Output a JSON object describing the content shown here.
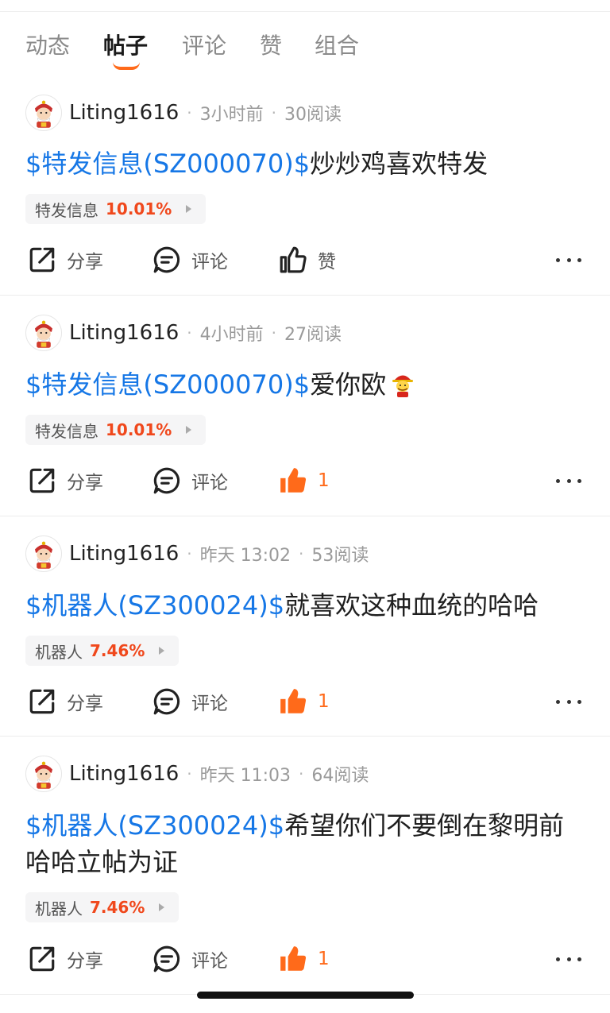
{
  "tabs": [
    {
      "label": "动态",
      "active": false
    },
    {
      "label": "帖子",
      "active": true
    },
    {
      "label": "评论",
      "active": false
    },
    {
      "label": "赞",
      "active": false
    },
    {
      "label": "组合",
      "active": false
    }
  ],
  "colors": {
    "accent": "#ff6a1a",
    "link": "#1677e6",
    "up": "#f0481c"
  },
  "icons": {
    "avatar": "cartoon-avatar-icon",
    "share": "share-icon",
    "comment": "comment-icon",
    "like": "thumbs-up-icon",
    "more": "more-dots-icon",
    "emoji": "god-of-wealth-emoji-icon"
  },
  "actions": {
    "share": "分享",
    "comment": "评论",
    "like": "赞"
  },
  "posts": [
    {
      "user": "Liting1616",
      "time": "3小时前",
      "reads": "30阅读",
      "stock_link": "$特发信息(SZ000070)$",
      "text": "炒炒鸡喜欢特发",
      "chip_name": "特发信息",
      "chip_pct": "10.01%",
      "like_label": "赞",
      "liked": false
    },
    {
      "user": "Liting1616",
      "time": "4小时前",
      "reads": "27阅读",
      "stock_link": "$特发信息(SZ000070)$",
      "text": "爱你欧",
      "chip_name": "特发信息",
      "chip_pct": "10.01%",
      "like_label": "1",
      "liked": true
    },
    {
      "user": "Liting1616",
      "time": "昨天 13:02",
      "reads": "53阅读",
      "stock_link": "$机器人(SZ300024)$",
      "text": "就喜欢这种血统的哈哈",
      "chip_name": "机器人",
      "chip_pct": "7.46%",
      "like_label": "1",
      "liked": true
    },
    {
      "user": "Liting1616",
      "time": "昨天 11:03",
      "reads": "64阅读",
      "stock_link": "$机器人(SZ300024)$",
      "text": "希望你们不要倒在黎明前哈哈立帖为证",
      "chip_name": "机器人",
      "chip_pct": "7.46%",
      "like_label": "1",
      "liked": true
    }
  ]
}
